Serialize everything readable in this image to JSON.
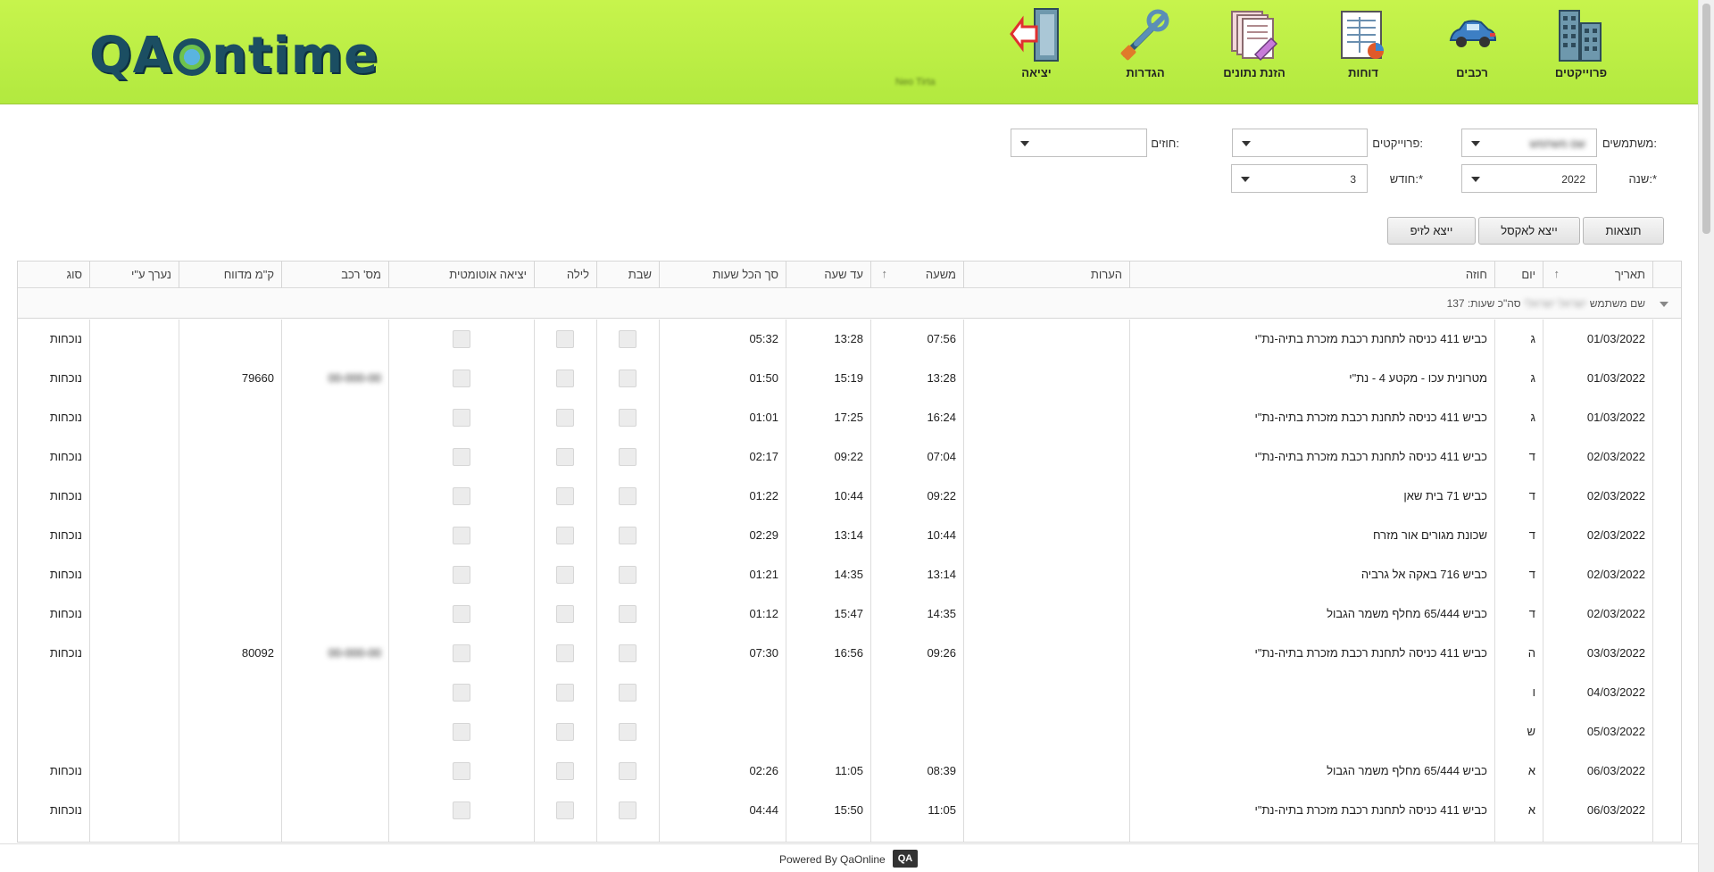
{
  "app": {
    "logo": "QAOntime",
    "header_center": "Neo Tirta"
  },
  "nav": [
    {
      "label": "פרוייקטים",
      "icon": "buildings-icon"
    },
    {
      "label": "רכבים",
      "icon": "car-icon"
    },
    {
      "label": "דוחות",
      "icon": "report-icon"
    },
    {
      "label": "הזנת נתונים",
      "icon": "data-entry-icon"
    },
    {
      "label": "הגדרות",
      "icon": "settings-tools-icon"
    },
    {
      "label": "יציאה",
      "icon": "exit-icon"
    }
  ],
  "filters": {
    "user_label": "משתמשים:",
    "user_value": "שם משתמש",
    "projects_label": "פרוייקטים:",
    "projects_value": "",
    "contracts_label": "חוזים:",
    "contracts_value": "",
    "year_label": "שנה:*",
    "year_value": "2022",
    "month_label": "חודש:*",
    "month_value": "3"
  },
  "buttons": {
    "results": "תוצאות",
    "export_excel": "ייצא לאקסל",
    "export_zip": "ייצא לזיפ"
  },
  "columns": {
    "date": "תאריך",
    "day": "יום",
    "contract": "חוזה",
    "notes": "הערות",
    "from_hour": "משעה",
    "to_hour": "עד שעה",
    "total_hours": "סך הכל שעות",
    "shabbat": "שבת",
    "night": "לילה",
    "auto_exit": "יציאה אוטומטית",
    "car_no": "מס' רכב",
    "km": "ק\"מ מדווח",
    "done_by": "נערך ע\"י",
    "type": "סוג"
  },
  "group": {
    "prefix": "שם משתמש",
    "user": "ישראל ישראלי",
    "total": "סה\"כ שעות: 137"
  },
  "rows": [
    {
      "date": "01/03/2022",
      "day": "ג",
      "contract": "כביש 411 כניסה לתחנת רכבת מזכרת בתיה-נת\"י",
      "from": "07:56",
      "to": "13:28",
      "total": "05:32",
      "car": "",
      "km": "",
      "type": "נוכחות"
    },
    {
      "date": "01/03/2022",
      "day": "ג",
      "contract": "מטרונית עכו - מקטע 4 - נת\"י",
      "from": "13:28",
      "to": "15:19",
      "total": "01:50",
      "car": "00-000-00",
      "km": "79660",
      "type": "נוכחות"
    },
    {
      "date": "01/03/2022",
      "day": "ג",
      "contract": "כביש 411 כניסה לתחנת רכבת מזכרת בתיה-נת\"י",
      "from": "16:24",
      "to": "17:25",
      "total": "01:01",
      "car": "",
      "km": "",
      "type": "נוכחות"
    },
    {
      "date": "02/03/2022",
      "day": "ד",
      "contract": "כביש 411 כניסה לתחנת רכבת מזכרת בתיה-נת\"י",
      "from": "07:04",
      "to": "09:22",
      "total": "02:17",
      "car": "",
      "km": "",
      "type": "נוכחות"
    },
    {
      "date": "02/03/2022",
      "day": "ד",
      "contract": "כביש 71 בית שאן",
      "from": "09:22",
      "to": "10:44",
      "total": "01:22",
      "car": "",
      "km": "",
      "type": "נוכחות"
    },
    {
      "date": "02/03/2022",
      "day": "ד",
      "contract": "שכונת מגורים אור מזרח",
      "from": "10:44",
      "to": "13:14",
      "total": "02:29",
      "car": "",
      "km": "",
      "type": "נוכחות"
    },
    {
      "date": "02/03/2022",
      "day": "ד",
      "contract": "כביש 716 באקה אל גרביה",
      "from": "13:14",
      "to": "14:35",
      "total": "01:21",
      "car": "",
      "km": "",
      "type": "נוכחות"
    },
    {
      "date": "02/03/2022",
      "day": "ד",
      "contract": "כביש 65/444 מחלף משמר הגבול",
      "from": "14:35",
      "to": "15:47",
      "total": "01:12",
      "car": "",
      "km": "",
      "type": "נוכחות"
    },
    {
      "date": "03/03/2022",
      "day": "ה",
      "contract": "כביש 411 כניסה לתחנת רכבת מזכרת בתיה-נת\"י",
      "from": "09:26",
      "to": "16:56",
      "total": "07:30",
      "car": "00-000-00",
      "km": "80092",
      "type": "נוכחות"
    },
    {
      "date": "04/03/2022",
      "day": "ו",
      "contract": "",
      "from": "",
      "to": "",
      "total": "",
      "car": "",
      "km": "",
      "type": ""
    },
    {
      "date": "05/03/2022",
      "day": "ש",
      "contract": "",
      "from": "",
      "to": "",
      "total": "",
      "car": "",
      "km": "",
      "type": ""
    },
    {
      "date": "06/03/2022",
      "day": "א",
      "contract": "כביש 65/444 מחלף משמר הגבול",
      "from": "08:39",
      "to": "11:05",
      "total": "02:26",
      "car": "",
      "km": "",
      "type": "נוכחות"
    },
    {
      "date": "06/03/2022",
      "day": "א",
      "contract": "כביש 411 כניסה לתחנת רכבת מזכרת בתיה-נת\"י",
      "from": "11:05",
      "to": "15:50",
      "total": "04:44",
      "car": "",
      "km": "",
      "type": "נוכחות"
    }
  ],
  "footer": {
    "text": "Powered By QaOnline",
    "badge": "QA"
  }
}
